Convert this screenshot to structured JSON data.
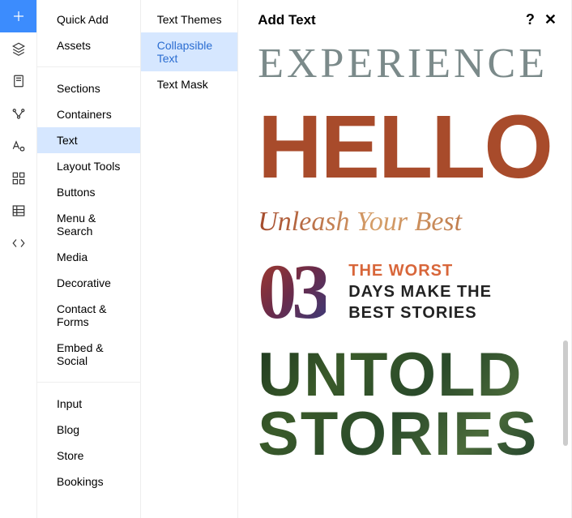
{
  "iconbar": {
    "items": [
      {
        "name": "add-icon"
      },
      {
        "name": "layers-icon"
      },
      {
        "name": "page-icon"
      },
      {
        "name": "nodes-icon"
      },
      {
        "name": "text-style-icon"
      },
      {
        "name": "grid-icon"
      },
      {
        "name": "table-icon"
      },
      {
        "name": "code-icon"
      }
    ],
    "activeIndex": 0
  },
  "col1": {
    "groups": [
      {
        "items": [
          {
            "label": "Quick Add"
          },
          {
            "label": "Assets"
          }
        ]
      },
      {
        "items": [
          {
            "label": "Sections"
          },
          {
            "label": "Containers"
          },
          {
            "label": "Text",
            "selected": true
          },
          {
            "label": "Layout Tools"
          },
          {
            "label": "Buttons"
          },
          {
            "label": "Menu & Search"
          },
          {
            "label": "Media"
          },
          {
            "label": "Decorative"
          },
          {
            "label": "Contact & Forms"
          },
          {
            "label": "Embed & Social"
          }
        ]
      },
      {
        "items": [
          {
            "label": "Input"
          },
          {
            "label": "Blog"
          },
          {
            "label": "Store"
          },
          {
            "label": "Bookings"
          }
        ]
      }
    ]
  },
  "col2": {
    "items": [
      {
        "label": "Text Themes"
      },
      {
        "label": "Collapsible Text",
        "selected": true
      },
      {
        "label": "Text Mask"
      }
    ]
  },
  "header": {
    "title": "Add Text",
    "help": "?",
    "close": "✕"
  },
  "samples": {
    "experience": "EXPERIENCE",
    "hello": "HELLO",
    "unleash": "Unleash Your Best",
    "num": "03",
    "worst_l1": "THE WORST",
    "worst_l2": "DAYS MAKE THE",
    "worst_l3": "BEST STORIES",
    "untold_l1": "UNTOLD",
    "untold_l2": "STORIES"
  }
}
